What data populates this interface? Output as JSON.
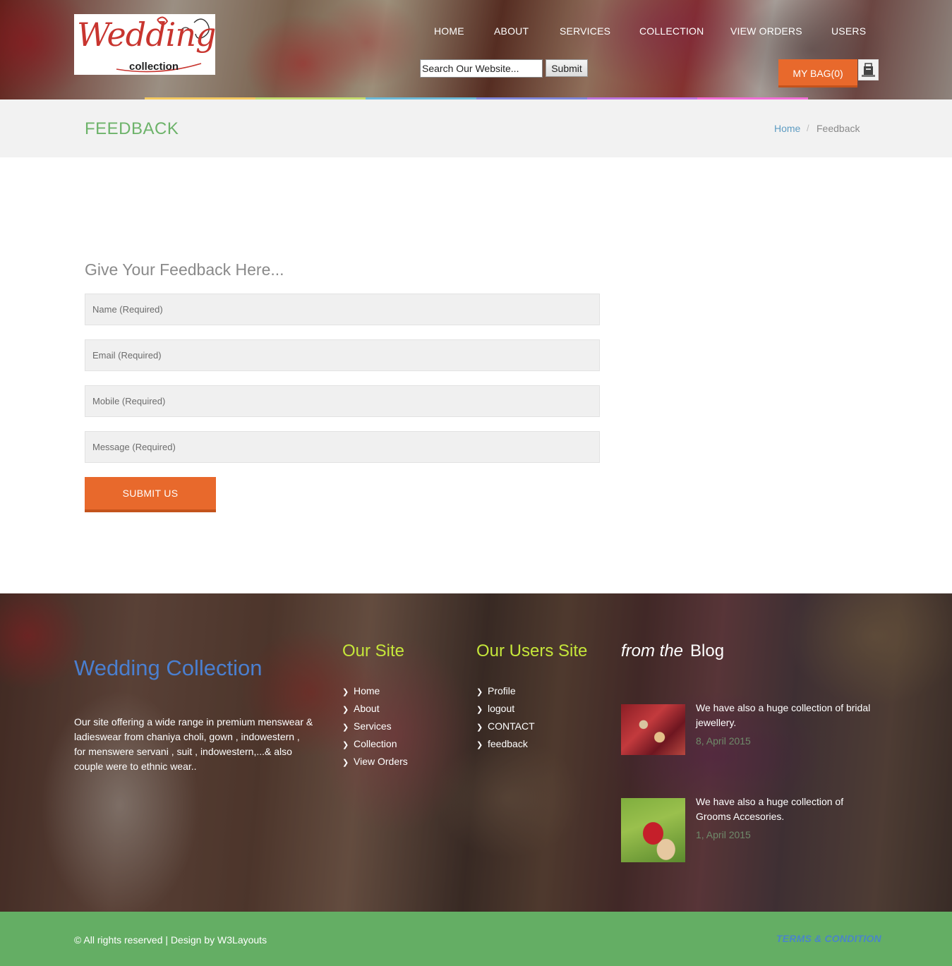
{
  "header": {
    "logo": {
      "wordmark": "Wedding",
      "sub": "collection"
    },
    "nav": [
      "HOME",
      "ABOUT",
      "SERVICES",
      "COLLECTION",
      "VIEW ORDERS",
      "USERS"
    ],
    "search": {
      "value": "Search Our Website...",
      "button": "Submit"
    },
    "bag": {
      "label": "MY BAG(0)",
      "icon": "shopping-bag-icon"
    },
    "color_strip": [
      "#f4c960",
      "#c4dc6e",
      "#6cbad8",
      "#7f86da",
      "#bc74de",
      "#f06ed6"
    ]
  },
  "title_band": {
    "title": "FEEDBACK",
    "breadcrumb": {
      "home": "Home",
      "separator": "/",
      "current": "Feedback"
    }
  },
  "form": {
    "heading": "Give Your Feedback Here...",
    "fields": [
      {
        "placeholder": "Name (Required)"
      },
      {
        "placeholder": "Email (Required)"
      },
      {
        "placeholder": "Mobile (Required)"
      },
      {
        "placeholder": "Message (Required)"
      }
    ],
    "submit": "SUBMIT US"
  },
  "footer": {
    "brand": "Wedding Collection",
    "about": "Our site offering a wide range in premium menswear & ladieswear from chaniya choli, gown , indowestern , for menswere servani , suit , indowestern,...& also couple were to ethnic wear..",
    "our_site": {
      "title": "Our Site",
      "links": [
        "Home",
        "About",
        "Services",
        "Collection",
        "View Orders"
      ]
    },
    "users_site": {
      "title": "Our Users Site",
      "links": [
        "Profile",
        "logout",
        "CONTACT",
        "feedback"
      ]
    },
    "blog": {
      "title_prefix": "from the",
      "title": "Blog",
      "posts": [
        {
          "text": "We have also a huge collection of bridal jewellery.",
          "date": "8, April 2015"
        },
        {
          "text": "We have also a huge collection of Grooms Accesories.",
          "date": "1, April 2015"
        }
      ]
    }
  },
  "bottom": {
    "copyright": "© All rights reserved | Design by W3Layouts",
    "terms": "TERMS & CONDITION"
  }
}
